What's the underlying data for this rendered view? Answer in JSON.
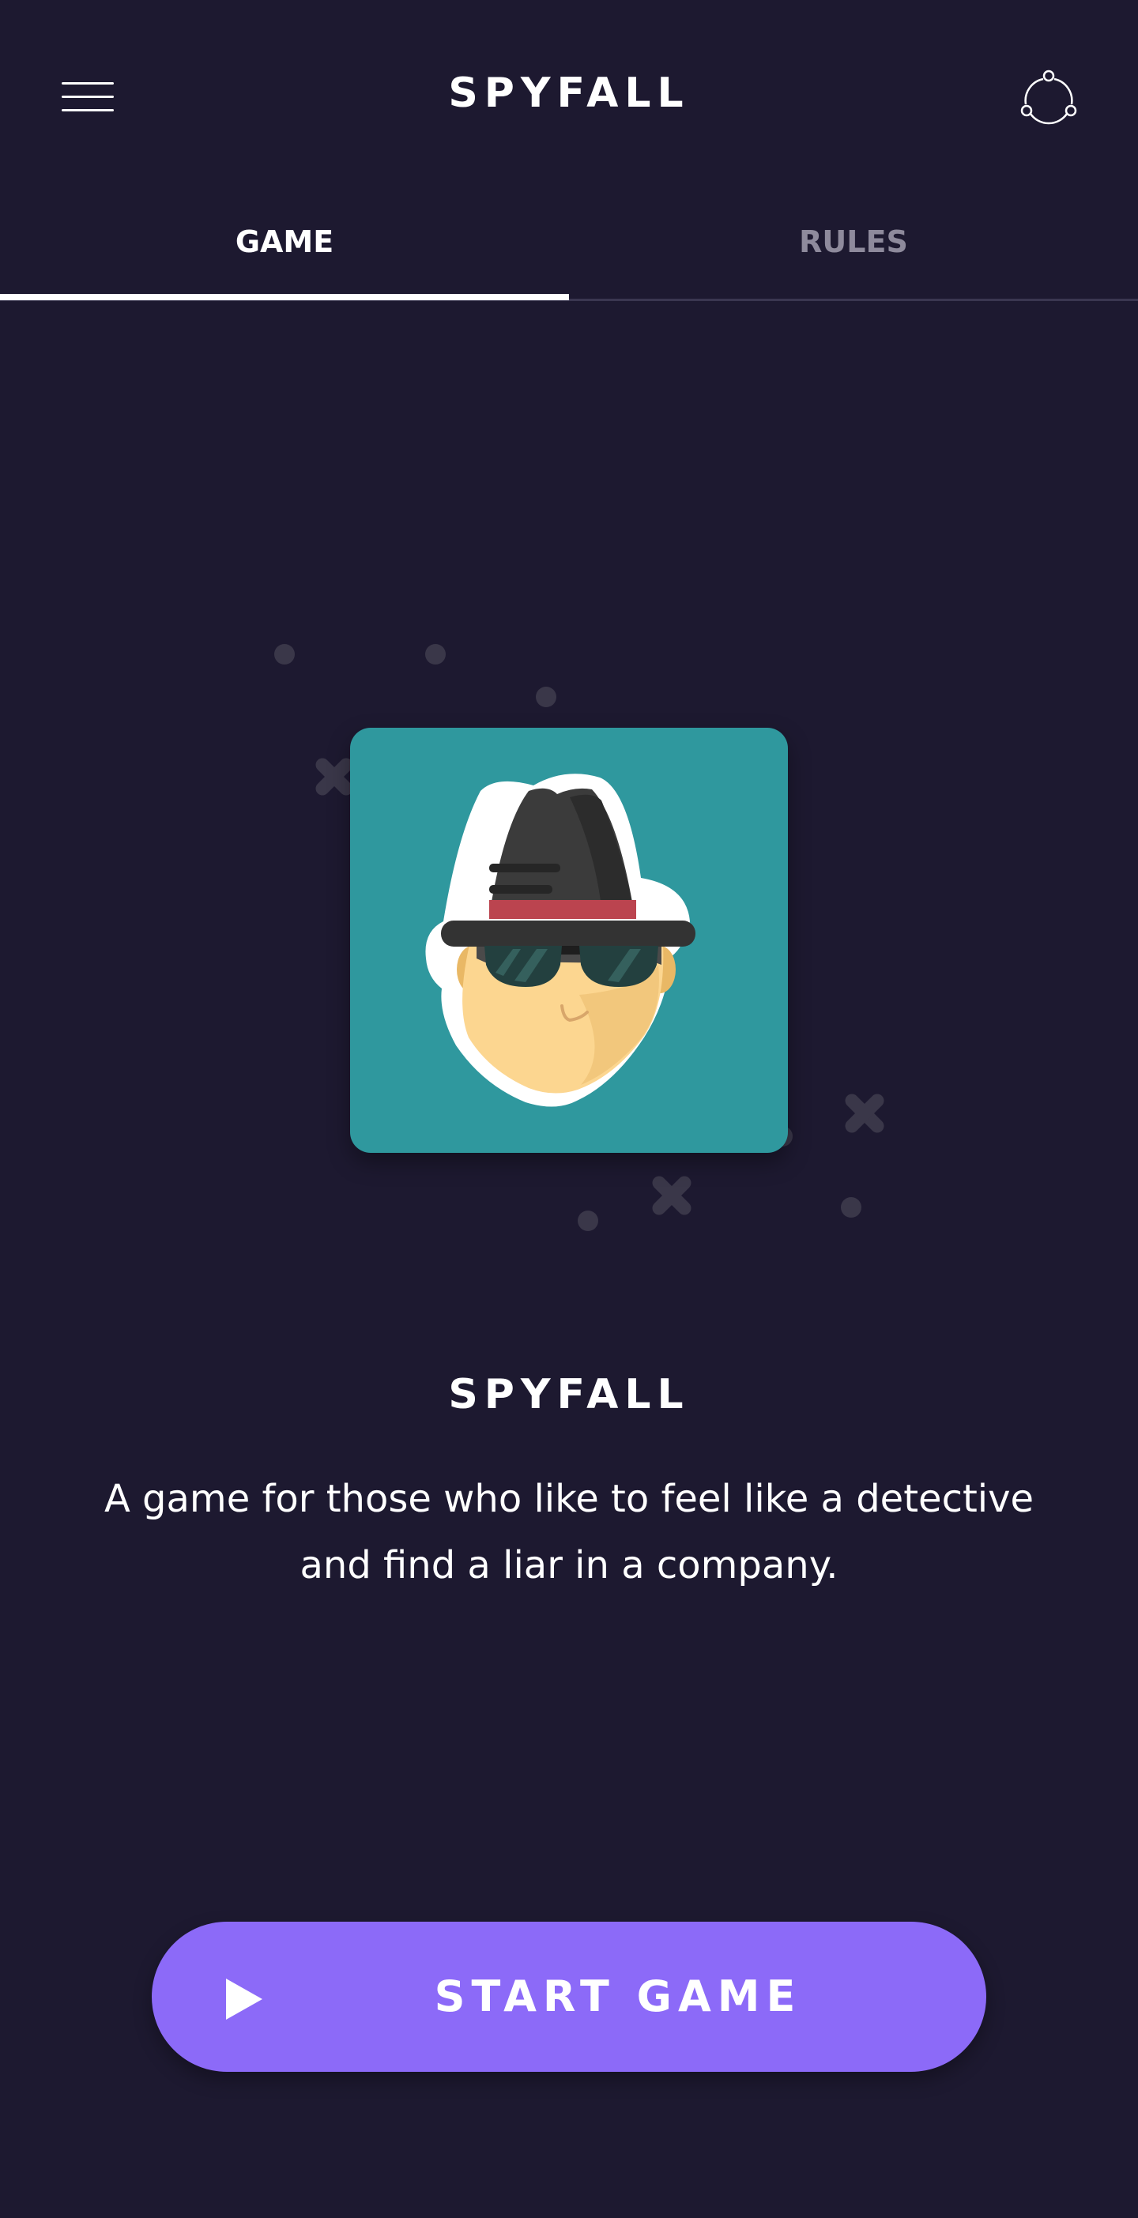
{
  "header": {
    "title": "SPYFALL",
    "menu_icon": "hamburger-menu-icon",
    "share_icon": "share-icon"
  },
  "tabs": [
    {
      "label": "GAME",
      "active": true
    },
    {
      "label": "RULES",
      "active": false
    }
  ],
  "main": {
    "illustration": "spy-avatar",
    "title": "SPYFALL",
    "description": "A game for those who like to feel like a detective and find a liar in a company."
  },
  "start_button": {
    "label": "START GAME",
    "icon": "play-icon"
  },
  "colors": {
    "background": "#1d1930",
    "accent": "#8c6af8",
    "card": "#2f989e",
    "inactive_tab": "#8e8a9c"
  }
}
